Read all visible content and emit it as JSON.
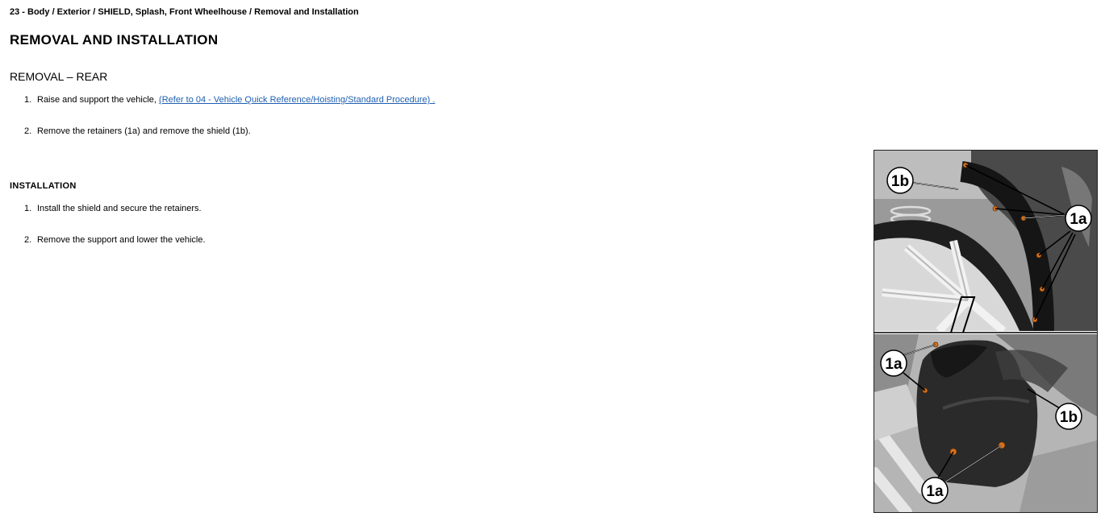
{
  "breadcrumb": "23 - Body / Exterior / SHIELD, Splash, Front Wheelhouse / Removal and Installation",
  "title": "REMOVAL AND INSTALLATION",
  "removal": {
    "heading": "REMOVAL – REAR",
    "steps": [
      {
        "num": "1.",
        "text": "Raise and support the vehicle, ",
        "link": "(Refer to 04 - Vehicle Quick Reference/Hoisting/Standard Procedure) ."
      },
      {
        "num": "2.",
        "text": "Remove the retainers (1a) and remove the shield (1b)."
      }
    ]
  },
  "installation": {
    "heading": "INSTALLATION",
    "steps": [
      {
        "num": "1.",
        "text": "Install the shield and secure the retainers."
      },
      {
        "num": "2.",
        "text": "Remove the support and lower the vehicle."
      }
    ]
  },
  "figure": {
    "callouts": {
      "top_shield": "1b",
      "top_retainers": "1a",
      "bottom_retainers_upper": "1a",
      "bottom_shield": "1b",
      "bottom_retainers_lower": "1a"
    },
    "colors": {
      "retainer": "#d9731e",
      "photo_dark": "#2a2a2a",
      "photo_light": "#c8c8c8"
    }
  }
}
